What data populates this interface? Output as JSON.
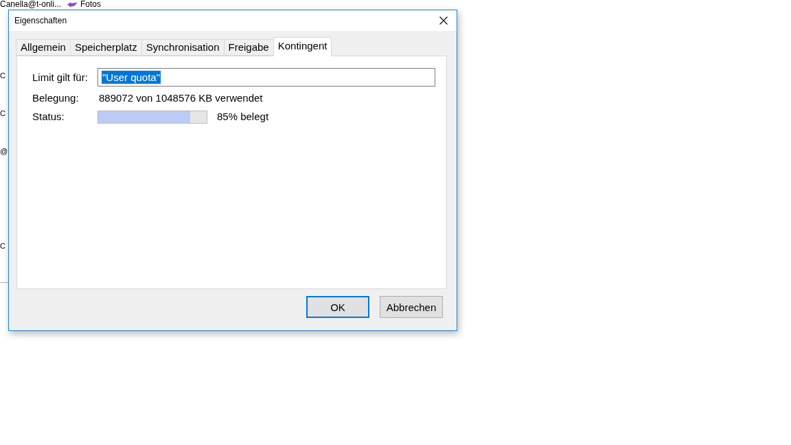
{
  "background": {
    "account": "Canella@t-onli...",
    "folder": "Fotos",
    "list_fragments": [
      "C",
      "C",
      "@",
      "C"
    ]
  },
  "dialog": {
    "title": "Eigenschaften",
    "tabs": [
      {
        "label": "Allgemein",
        "selected": false
      },
      {
        "label": "Speicherplatz",
        "selected": false
      },
      {
        "label": "Synchronisation",
        "selected": false
      },
      {
        "label": "Freigabe",
        "selected": false
      },
      {
        "label": "Kontingent",
        "selected": true
      }
    ],
    "quota": {
      "limit_label": "Limit gilt für:",
      "limit_value": "\"User quota\"",
      "limit_value_selected": true,
      "usage_label": "Belegung:",
      "usage_value": "889072 von 1048576 KB verwendet",
      "status_label": "Status:",
      "level": 0.85,
      "status_value": "85% belegt"
    },
    "buttons": [
      {
        "label": "OK",
        "default": true
      },
      {
        "label": "Abbrechen",
        "default": false
      }
    ]
  }
}
